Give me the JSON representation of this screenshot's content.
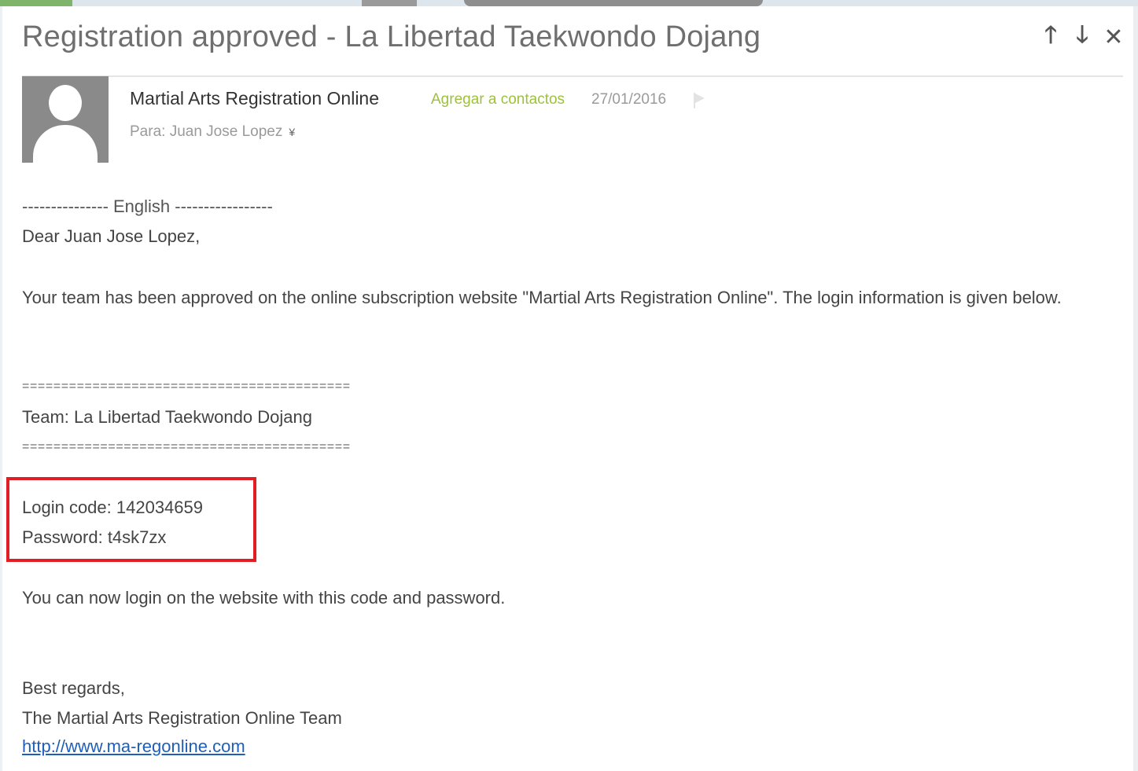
{
  "window": {
    "subject": "Registration approved - La Libertad Taekwondo Dojang",
    "nav": {
      "up_glyph": "🡑",
      "down_glyph": "🡓",
      "close_glyph": "✕"
    }
  },
  "header": {
    "sender": "Martial Arts Registration Online",
    "add_contact": "Agregar a contactos",
    "date": "27/01/2016",
    "recipient": "Para: Juan Jose Lopez",
    "recipient_chevron": "¥"
  },
  "message": {
    "lang_separator": "--------------- English -----------------",
    "greeting": "Dear Juan Jose Lopez,",
    "intro": "Your team has been approved on the online subscription website \"Martial Arts Registration Online\". The login information is given below.",
    "rule_top": "==========================================",
    "team": "Team: La Libertad Taekwondo Dojang",
    "rule_bottom": "==========================================",
    "login_code": "Login code: 142034659",
    "password": "Password: t4sk7zx",
    "instructions": "You can now login on the website with this code and password.",
    "closing": "Best regards,",
    "signature": "The Martial Arts Registration Online Team",
    "website": "http://www.ma-regonline.com"
  },
  "colors": {
    "accent_green": "#9ec13d",
    "highlight_red": "#e01e24",
    "link_blue": "#1f5fb8"
  },
  "icons": [
    "arrow-up-icon",
    "arrow-down-icon",
    "close-icon",
    "avatar-placeholder-icon",
    "flag-icon",
    "chevron-down-icon"
  ]
}
